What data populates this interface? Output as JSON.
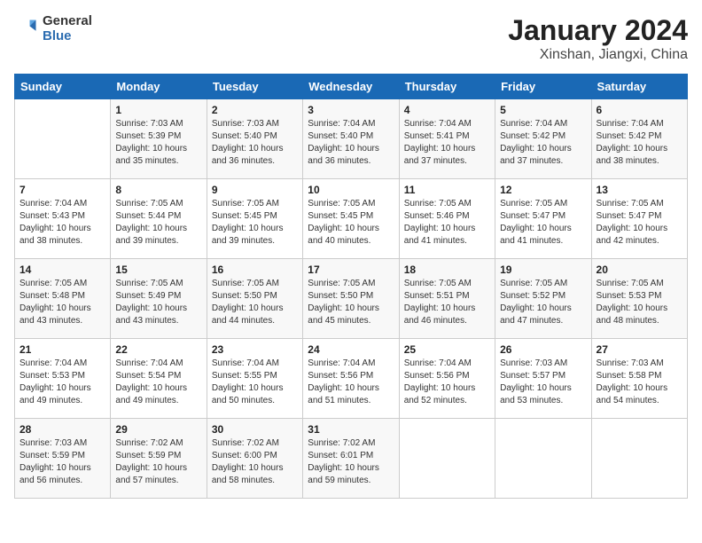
{
  "header": {
    "logo_general": "General",
    "logo_blue": "Blue",
    "title": "January 2024",
    "location": "Xinshan, Jiangxi, China"
  },
  "weekdays": [
    "Sunday",
    "Monday",
    "Tuesday",
    "Wednesday",
    "Thursday",
    "Friday",
    "Saturday"
  ],
  "weeks": [
    [
      {
        "day": "",
        "sunrise": "",
        "sunset": "",
        "daylight": ""
      },
      {
        "day": "1",
        "sunrise": "7:03 AM",
        "sunset": "5:39 PM",
        "daylight": "10 hours and 35 minutes."
      },
      {
        "day": "2",
        "sunrise": "7:03 AM",
        "sunset": "5:40 PM",
        "daylight": "10 hours and 36 minutes."
      },
      {
        "day": "3",
        "sunrise": "7:04 AM",
        "sunset": "5:40 PM",
        "daylight": "10 hours and 36 minutes."
      },
      {
        "day": "4",
        "sunrise": "7:04 AM",
        "sunset": "5:41 PM",
        "daylight": "10 hours and 37 minutes."
      },
      {
        "day": "5",
        "sunrise": "7:04 AM",
        "sunset": "5:42 PM",
        "daylight": "10 hours and 37 minutes."
      },
      {
        "day": "6",
        "sunrise": "7:04 AM",
        "sunset": "5:42 PM",
        "daylight": "10 hours and 38 minutes."
      }
    ],
    [
      {
        "day": "7",
        "sunrise": "7:04 AM",
        "sunset": "5:43 PM",
        "daylight": "10 hours and 38 minutes."
      },
      {
        "day": "8",
        "sunrise": "7:05 AM",
        "sunset": "5:44 PM",
        "daylight": "10 hours and 39 minutes."
      },
      {
        "day": "9",
        "sunrise": "7:05 AM",
        "sunset": "5:45 PM",
        "daylight": "10 hours and 39 minutes."
      },
      {
        "day": "10",
        "sunrise": "7:05 AM",
        "sunset": "5:45 PM",
        "daylight": "10 hours and 40 minutes."
      },
      {
        "day": "11",
        "sunrise": "7:05 AM",
        "sunset": "5:46 PM",
        "daylight": "10 hours and 41 minutes."
      },
      {
        "day": "12",
        "sunrise": "7:05 AM",
        "sunset": "5:47 PM",
        "daylight": "10 hours and 41 minutes."
      },
      {
        "day": "13",
        "sunrise": "7:05 AM",
        "sunset": "5:47 PM",
        "daylight": "10 hours and 42 minutes."
      }
    ],
    [
      {
        "day": "14",
        "sunrise": "7:05 AM",
        "sunset": "5:48 PM",
        "daylight": "10 hours and 43 minutes."
      },
      {
        "day": "15",
        "sunrise": "7:05 AM",
        "sunset": "5:49 PM",
        "daylight": "10 hours and 43 minutes."
      },
      {
        "day": "16",
        "sunrise": "7:05 AM",
        "sunset": "5:50 PM",
        "daylight": "10 hours and 44 minutes."
      },
      {
        "day": "17",
        "sunrise": "7:05 AM",
        "sunset": "5:50 PM",
        "daylight": "10 hours and 45 minutes."
      },
      {
        "day": "18",
        "sunrise": "7:05 AM",
        "sunset": "5:51 PM",
        "daylight": "10 hours and 46 minutes."
      },
      {
        "day": "19",
        "sunrise": "7:05 AM",
        "sunset": "5:52 PM",
        "daylight": "10 hours and 47 minutes."
      },
      {
        "day": "20",
        "sunrise": "7:05 AM",
        "sunset": "5:53 PM",
        "daylight": "10 hours and 48 minutes."
      }
    ],
    [
      {
        "day": "21",
        "sunrise": "7:04 AM",
        "sunset": "5:53 PM",
        "daylight": "10 hours and 49 minutes."
      },
      {
        "day": "22",
        "sunrise": "7:04 AM",
        "sunset": "5:54 PM",
        "daylight": "10 hours and 49 minutes."
      },
      {
        "day": "23",
        "sunrise": "7:04 AM",
        "sunset": "5:55 PM",
        "daylight": "10 hours and 50 minutes."
      },
      {
        "day": "24",
        "sunrise": "7:04 AM",
        "sunset": "5:56 PM",
        "daylight": "10 hours and 51 minutes."
      },
      {
        "day": "25",
        "sunrise": "7:04 AM",
        "sunset": "5:56 PM",
        "daylight": "10 hours and 52 minutes."
      },
      {
        "day": "26",
        "sunrise": "7:03 AM",
        "sunset": "5:57 PM",
        "daylight": "10 hours and 53 minutes."
      },
      {
        "day": "27",
        "sunrise": "7:03 AM",
        "sunset": "5:58 PM",
        "daylight": "10 hours and 54 minutes."
      }
    ],
    [
      {
        "day": "28",
        "sunrise": "7:03 AM",
        "sunset": "5:59 PM",
        "daylight": "10 hours and 56 minutes."
      },
      {
        "day": "29",
        "sunrise": "7:02 AM",
        "sunset": "5:59 PM",
        "daylight": "10 hours and 57 minutes."
      },
      {
        "day": "30",
        "sunrise": "7:02 AM",
        "sunset": "6:00 PM",
        "daylight": "10 hours and 58 minutes."
      },
      {
        "day": "31",
        "sunrise": "7:02 AM",
        "sunset": "6:01 PM",
        "daylight": "10 hours and 59 minutes."
      },
      {
        "day": "",
        "sunrise": "",
        "sunset": "",
        "daylight": ""
      },
      {
        "day": "",
        "sunrise": "",
        "sunset": "",
        "daylight": ""
      },
      {
        "day": "",
        "sunrise": "",
        "sunset": "",
        "daylight": ""
      }
    ]
  ]
}
